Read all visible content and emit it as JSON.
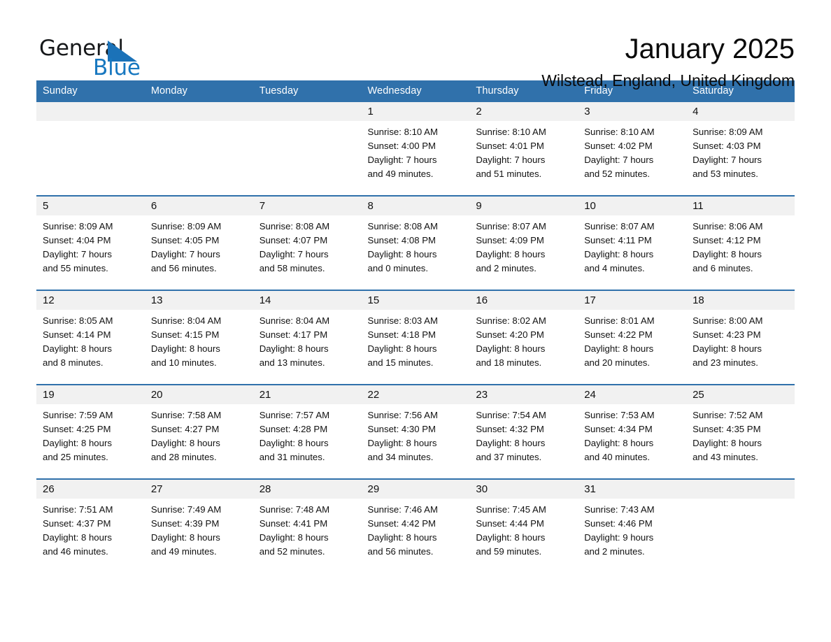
{
  "brand": {
    "name_part1": "General",
    "name_part2": "Blue",
    "triangle_color": "#1b72b8",
    "blue_text_color": "#1878c0"
  },
  "header": {
    "month_title": "January 2025",
    "location": "Wilstead, England, United Kingdom"
  },
  "theme": {
    "header_blue": "#3071ab",
    "daynum_strip": "#f1f1f1",
    "cell_background": "#ffffff",
    "text_color": "#111111"
  },
  "calendar": {
    "weekday_headers": [
      "Sunday",
      "Monday",
      "Tuesday",
      "Wednesday",
      "Thursday",
      "Friday",
      "Saturday"
    ],
    "weeks": [
      [
        {
          "day": "",
          "lines": []
        },
        {
          "day": "",
          "lines": []
        },
        {
          "day": "",
          "lines": []
        },
        {
          "day": "1",
          "lines": [
            "Sunrise: 8:10 AM",
            "Sunset: 4:00 PM",
            "Daylight: 7 hours",
            "and 49 minutes."
          ]
        },
        {
          "day": "2",
          "lines": [
            "Sunrise: 8:10 AM",
            "Sunset: 4:01 PM",
            "Daylight: 7 hours",
            "and 51 minutes."
          ]
        },
        {
          "day": "3",
          "lines": [
            "Sunrise: 8:10 AM",
            "Sunset: 4:02 PM",
            "Daylight: 7 hours",
            "and 52 minutes."
          ]
        },
        {
          "day": "4",
          "lines": [
            "Sunrise: 8:09 AM",
            "Sunset: 4:03 PM",
            "Daylight: 7 hours",
            "and 53 minutes."
          ]
        }
      ],
      [
        {
          "day": "5",
          "lines": [
            "Sunrise: 8:09 AM",
            "Sunset: 4:04 PM",
            "Daylight: 7 hours",
            "and 55 minutes."
          ]
        },
        {
          "day": "6",
          "lines": [
            "Sunrise: 8:09 AM",
            "Sunset: 4:05 PM",
            "Daylight: 7 hours",
            "and 56 minutes."
          ]
        },
        {
          "day": "7",
          "lines": [
            "Sunrise: 8:08 AM",
            "Sunset: 4:07 PM",
            "Daylight: 7 hours",
            "and 58 minutes."
          ]
        },
        {
          "day": "8",
          "lines": [
            "Sunrise: 8:08 AM",
            "Sunset: 4:08 PM",
            "Daylight: 8 hours",
            "and 0 minutes."
          ]
        },
        {
          "day": "9",
          "lines": [
            "Sunrise: 8:07 AM",
            "Sunset: 4:09 PM",
            "Daylight: 8 hours",
            "and 2 minutes."
          ]
        },
        {
          "day": "10",
          "lines": [
            "Sunrise: 8:07 AM",
            "Sunset: 4:11 PM",
            "Daylight: 8 hours",
            "and 4 minutes."
          ]
        },
        {
          "day": "11",
          "lines": [
            "Sunrise: 8:06 AM",
            "Sunset: 4:12 PM",
            "Daylight: 8 hours",
            "and 6 minutes."
          ]
        }
      ],
      [
        {
          "day": "12",
          "lines": [
            "Sunrise: 8:05 AM",
            "Sunset: 4:14 PM",
            "Daylight: 8 hours",
            "and 8 minutes."
          ]
        },
        {
          "day": "13",
          "lines": [
            "Sunrise: 8:04 AM",
            "Sunset: 4:15 PM",
            "Daylight: 8 hours",
            "and 10 minutes."
          ]
        },
        {
          "day": "14",
          "lines": [
            "Sunrise: 8:04 AM",
            "Sunset: 4:17 PM",
            "Daylight: 8 hours",
            "and 13 minutes."
          ]
        },
        {
          "day": "15",
          "lines": [
            "Sunrise: 8:03 AM",
            "Sunset: 4:18 PM",
            "Daylight: 8 hours",
            "and 15 minutes."
          ]
        },
        {
          "day": "16",
          "lines": [
            "Sunrise: 8:02 AM",
            "Sunset: 4:20 PM",
            "Daylight: 8 hours",
            "and 18 minutes."
          ]
        },
        {
          "day": "17",
          "lines": [
            "Sunrise: 8:01 AM",
            "Sunset: 4:22 PM",
            "Daylight: 8 hours",
            "and 20 minutes."
          ]
        },
        {
          "day": "18",
          "lines": [
            "Sunrise: 8:00 AM",
            "Sunset: 4:23 PM",
            "Daylight: 8 hours",
            "and 23 minutes."
          ]
        }
      ],
      [
        {
          "day": "19",
          "lines": [
            "Sunrise: 7:59 AM",
            "Sunset: 4:25 PM",
            "Daylight: 8 hours",
            "and 25 minutes."
          ]
        },
        {
          "day": "20",
          "lines": [
            "Sunrise: 7:58 AM",
            "Sunset: 4:27 PM",
            "Daylight: 8 hours",
            "and 28 minutes."
          ]
        },
        {
          "day": "21",
          "lines": [
            "Sunrise: 7:57 AM",
            "Sunset: 4:28 PM",
            "Daylight: 8 hours",
            "and 31 minutes."
          ]
        },
        {
          "day": "22",
          "lines": [
            "Sunrise: 7:56 AM",
            "Sunset: 4:30 PM",
            "Daylight: 8 hours",
            "and 34 minutes."
          ]
        },
        {
          "day": "23",
          "lines": [
            "Sunrise: 7:54 AM",
            "Sunset: 4:32 PM",
            "Daylight: 8 hours",
            "and 37 minutes."
          ]
        },
        {
          "day": "24",
          "lines": [
            "Sunrise: 7:53 AM",
            "Sunset: 4:34 PM",
            "Daylight: 8 hours",
            "and 40 minutes."
          ]
        },
        {
          "day": "25",
          "lines": [
            "Sunrise: 7:52 AM",
            "Sunset: 4:35 PM",
            "Daylight: 8 hours",
            "and 43 minutes."
          ]
        }
      ],
      [
        {
          "day": "26",
          "lines": [
            "Sunrise: 7:51 AM",
            "Sunset: 4:37 PM",
            "Daylight: 8 hours",
            "and 46 minutes."
          ]
        },
        {
          "day": "27",
          "lines": [
            "Sunrise: 7:49 AM",
            "Sunset: 4:39 PM",
            "Daylight: 8 hours",
            "and 49 minutes."
          ]
        },
        {
          "day": "28",
          "lines": [
            "Sunrise: 7:48 AM",
            "Sunset: 4:41 PM",
            "Daylight: 8 hours",
            "and 52 minutes."
          ]
        },
        {
          "day": "29",
          "lines": [
            "Sunrise: 7:46 AM",
            "Sunset: 4:42 PM",
            "Daylight: 8 hours",
            "and 56 minutes."
          ]
        },
        {
          "day": "30",
          "lines": [
            "Sunrise: 7:45 AM",
            "Sunset: 4:44 PM",
            "Daylight: 8 hours",
            "and 59 minutes."
          ]
        },
        {
          "day": "31",
          "lines": [
            "Sunrise: 7:43 AM",
            "Sunset: 4:46 PM",
            "Daylight: 9 hours",
            "and 2 minutes."
          ]
        },
        {
          "day": "",
          "lines": []
        }
      ]
    ]
  }
}
